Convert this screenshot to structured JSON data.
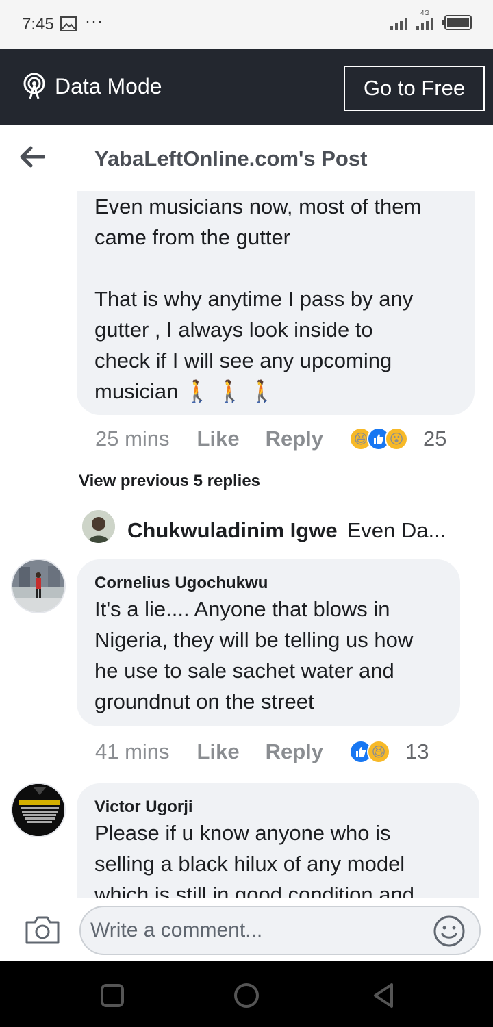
{
  "status_bar": {
    "time": "7:45",
    "dots": "···",
    "network": "4G"
  },
  "data_mode": {
    "label": "Data Mode",
    "button": "Go to Free"
  },
  "header": {
    "title": "YabaLeftOnline.com's Post"
  },
  "comments": [
    {
      "text": "Even musicians now, most of them\ncame from the gutter\n\nThat is why anytime I pass by any\ngutter , I always look inside to\ncheck if I will see any upcoming\nmusician 🚶 🚶 🚶",
      "time": "25 mins",
      "like": "Like",
      "reply": "Reply",
      "reactions": [
        "haha",
        "like",
        "wow"
      ],
      "count": "25"
    },
    {
      "author": "Cornelius Ugochukwu",
      "text": "It's a lie.... Anyone that blows in\nNigeria, they will be telling us how\nhe use to sale sachet water and\ngroundnut on the street",
      "time": "41 mins",
      "like": "Like",
      "reply": "Reply",
      "reactions": [
        "like",
        "haha"
      ],
      "count": "13"
    },
    {
      "author": "Victor Ugorji",
      "text": "Please if u know anyone  who is\nselling a black hilux of any model\nwhich is still in good condition and"
    }
  ],
  "view_previous": "View previous 5 replies",
  "reply_preview": {
    "author": "Chukwuladinim Igwe",
    "snippet": "Even Da..."
  },
  "avatar_victor_text": "ENTREPRENEURSHIP",
  "composer": {
    "placeholder": "Write a comment..."
  },
  "colors": {
    "data_bar": "#23272f",
    "bubble": "#f0f2f5",
    "meta": "#8a8d91",
    "like_blue": "#1877f2",
    "haha_yellow": "#f7b928"
  }
}
